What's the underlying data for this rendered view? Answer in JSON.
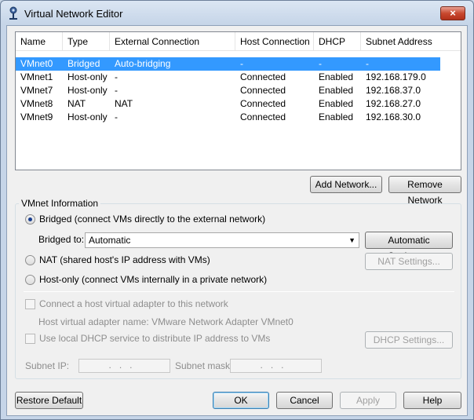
{
  "window": {
    "title": "Virtual Network Editor",
    "close_glyph": "×"
  },
  "table": {
    "columns": [
      "Name",
      "Type",
      "External Connection",
      "Host Connection",
      "DHCP",
      "Subnet Address"
    ],
    "rows": [
      {
        "name": "VMnet0",
        "type": "Bridged",
        "external": "Auto-bridging",
        "host": "-",
        "dhcp": "-",
        "subnet": "-",
        "selected": true
      },
      {
        "name": "VMnet1",
        "type": "Host-only",
        "external": "-",
        "host": "Connected",
        "dhcp": "Enabled",
        "subnet": "192.168.179.0"
      },
      {
        "name": "VMnet7",
        "type": "Host-only",
        "external": "-",
        "host": "Connected",
        "dhcp": "Enabled",
        "subnet": "192.168.37.0"
      },
      {
        "name": "VMnet8",
        "type": "NAT",
        "external": "NAT",
        "host": "Connected",
        "dhcp": "Enabled",
        "subnet": "192.168.27.0"
      },
      {
        "name": "VMnet9",
        "type": "Host-only",
        "external": "-",
        "host": "Connected",
        "dhcp": "Enabled",
        "subnet": "192.168.30.0"
      }
    ]
  },
  "buttons": {
    "add_network": "Add Network...",
    "remove_network": "Remove Network",
    "automatic_settings": "Automatic Settings...",
    "nat_settings": "NAT Settings...",
    "dhcp_settings": "DHCP Settings...",
    "restore_default": "Restore Default",
    "ok": "OK",
    "cancel": "Cancel",
    "apply": "Apply",
    "help": "Help"
  },
  "vmnet_info": {
    "group_label": "VMnet Information",
    "bridged_label": "Bridged (connect VMs directly to the external network)",
    "bridged_to_label": "Bridged to:",
    "bridged_to_value": "Automatic",
    "nat_label": "NAT (shared host's IP address with VMs)",
    "hostonly_label": "Host-only (connect VMs internally in a private network)",
    "connect_adapter_label": "Connect a host virtual adapter to this network",
    "adapter_name_label": "Host virtual adapter name: VMware Network Adapter VMnet0",
    "dhcp_label": "Use local DHCP service to distribute IP address to VMs",
    "subnet_ip_label": "Subnet IP:",
    "subnet_mask_label": "Subnet mask:",
    "ip_placeholder": "...",
    "selected_mode": "bridged"
  }
}
